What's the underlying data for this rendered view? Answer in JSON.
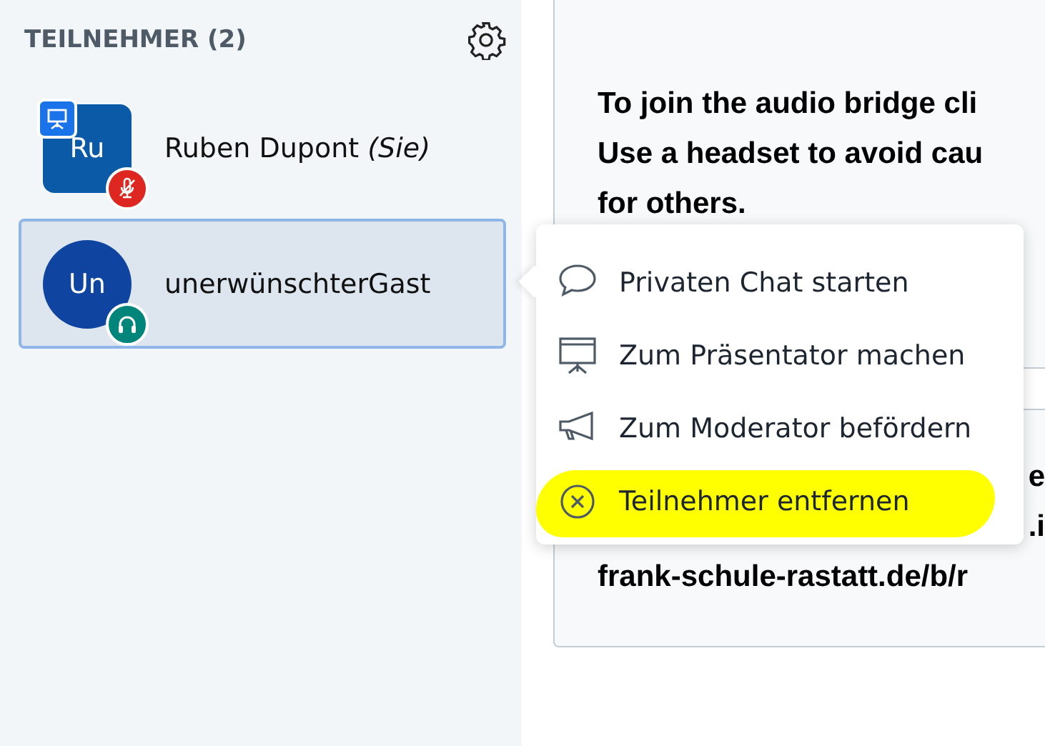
{
  "sidebar": {
    "title": "TEILNEHMER (2)",
    "users": [
      {
        "initials": "Ru",
        "name": "Ruben Dupont",
        "suffix": "(Sie)",
        "presenter": true,
        "muted": true,
        "selected": false,
        "color": "#0a5aa8"
      },
      {
        "initials": "Un",
        "name": "unerwünschterGast",
        "presenter": false,
        "muted": false,
        "selected": true,
        "color": "#0f45a0"
      }
    ]
  },
  "chat": {
    "messages": [
      {
        "lines": [
          "To join the audio bridge cli",
          "Use a headset to avoid cau",
          "for others."
        ]
      },
      {
        "lines": [
          "e",
          ".i",
          "frank-schule-rastatt.de/b/r"
        ]
      }
    ]
  },
  "menu": {
    "items": [
      {
        "kind": "chat",
        "label": "Privaten Chat starten",
        "highlighted": false
      },
      {
        "kind": "presenter",
        "label": "Zum Präsentator machen",
        "highlighted": false
      },
      {
        "kind": "moderator",
        "label": "Zum Moderator befördern",
        "highlighted": false
      },
      {
        "kind": "remove",
        "label": "Teilnehmer entfernen",
        "highlighted": true
      }
    ]
  }
}
